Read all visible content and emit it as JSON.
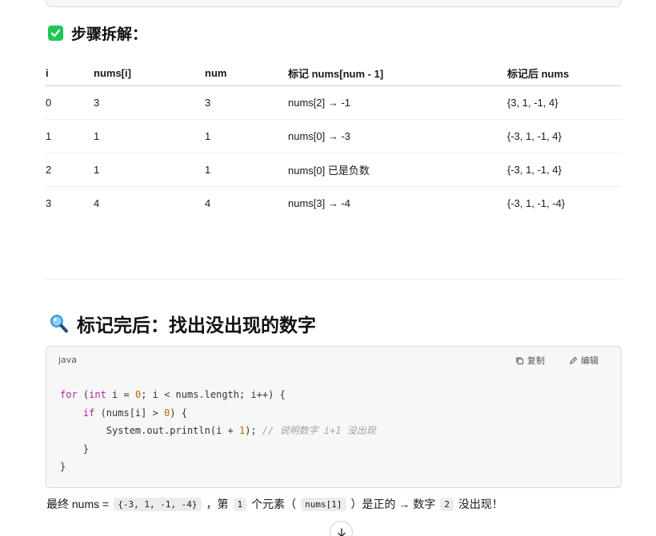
{
  "steps_heading": "步骤拆解：",
  "table": {
    "headers": [
      "i",
      "nums[i]",
      "num",
      "标记 nums[num - 1]",
      "标记后 nums"
    ],
    "rows": [
      [
        "0",
        "3",
        "3",
        "nums[2] → -1",
        "{3, 1, -1, 4}"
      ],
      [
        "1",
        "1",
        "1",
        "nums[0] → -3",
        "{-3, 1, -1, 4}"
      ],
      [
        "2",
        "1",
        "1",
        "nums[0] 已是负数",
        "{-3, 1, -1, 4}"
      ],
      [
        "3",
        "4",
        "4",
        "nums[3] → -4",
        "{-3, 1, -1, -4}"
      ]
    ]
  },
  "find_heading": "标记完后：找出没出现的数字",
  "code": {
    "language": "java",
    "copy_label": "复制",
    "edit_label": "编辑",
    "tokens": {
      "for": "for",
      "open_int": " (",
      "int": "int",
      "init": " i = ",
      "zero": "0",
      "loop_rest": "; i < nums.length; i++) {",
      "if": "if",
      "cond": " (nums[i] > ",
      "zero2": "0",
      "cond_end": ") {",
      "print": "System.out.println(i + ",
      "one": "1",
      "print_end": "); ",
      "comment": "// 说明数字 i+1 没出现",
      "close_inner": "}",
      "close_outer": "}"
    }
  },
  "conclusion": {
    "part1": "最终 nums =",
    "array_code": "{-3, 1, -1, -4}",
    "part2": "，第",
    "index_code": "1",
    "part3": "个元素（",
    "elem_code": "nums[1]",
    "part4": "）是正的 → 数字",
    "digit_code": "2",
    "part5": "没出现！"
  },
  "icons": {
    "steps_heading_icon": "check-box-icon",
    "find_heading_icon": "magnifier-icon",
    "copy_icon": "copy-icon",
    "edit_icon": "edit-icon",
    "scroll_icon": "arrow-down-icon"
  },
  "colors": {
    "check_green": "#23c553",
    "keyword": "#a626a4",
    "number": "#b76b01",
    "comment": "#a0a1a7"
  }
}
